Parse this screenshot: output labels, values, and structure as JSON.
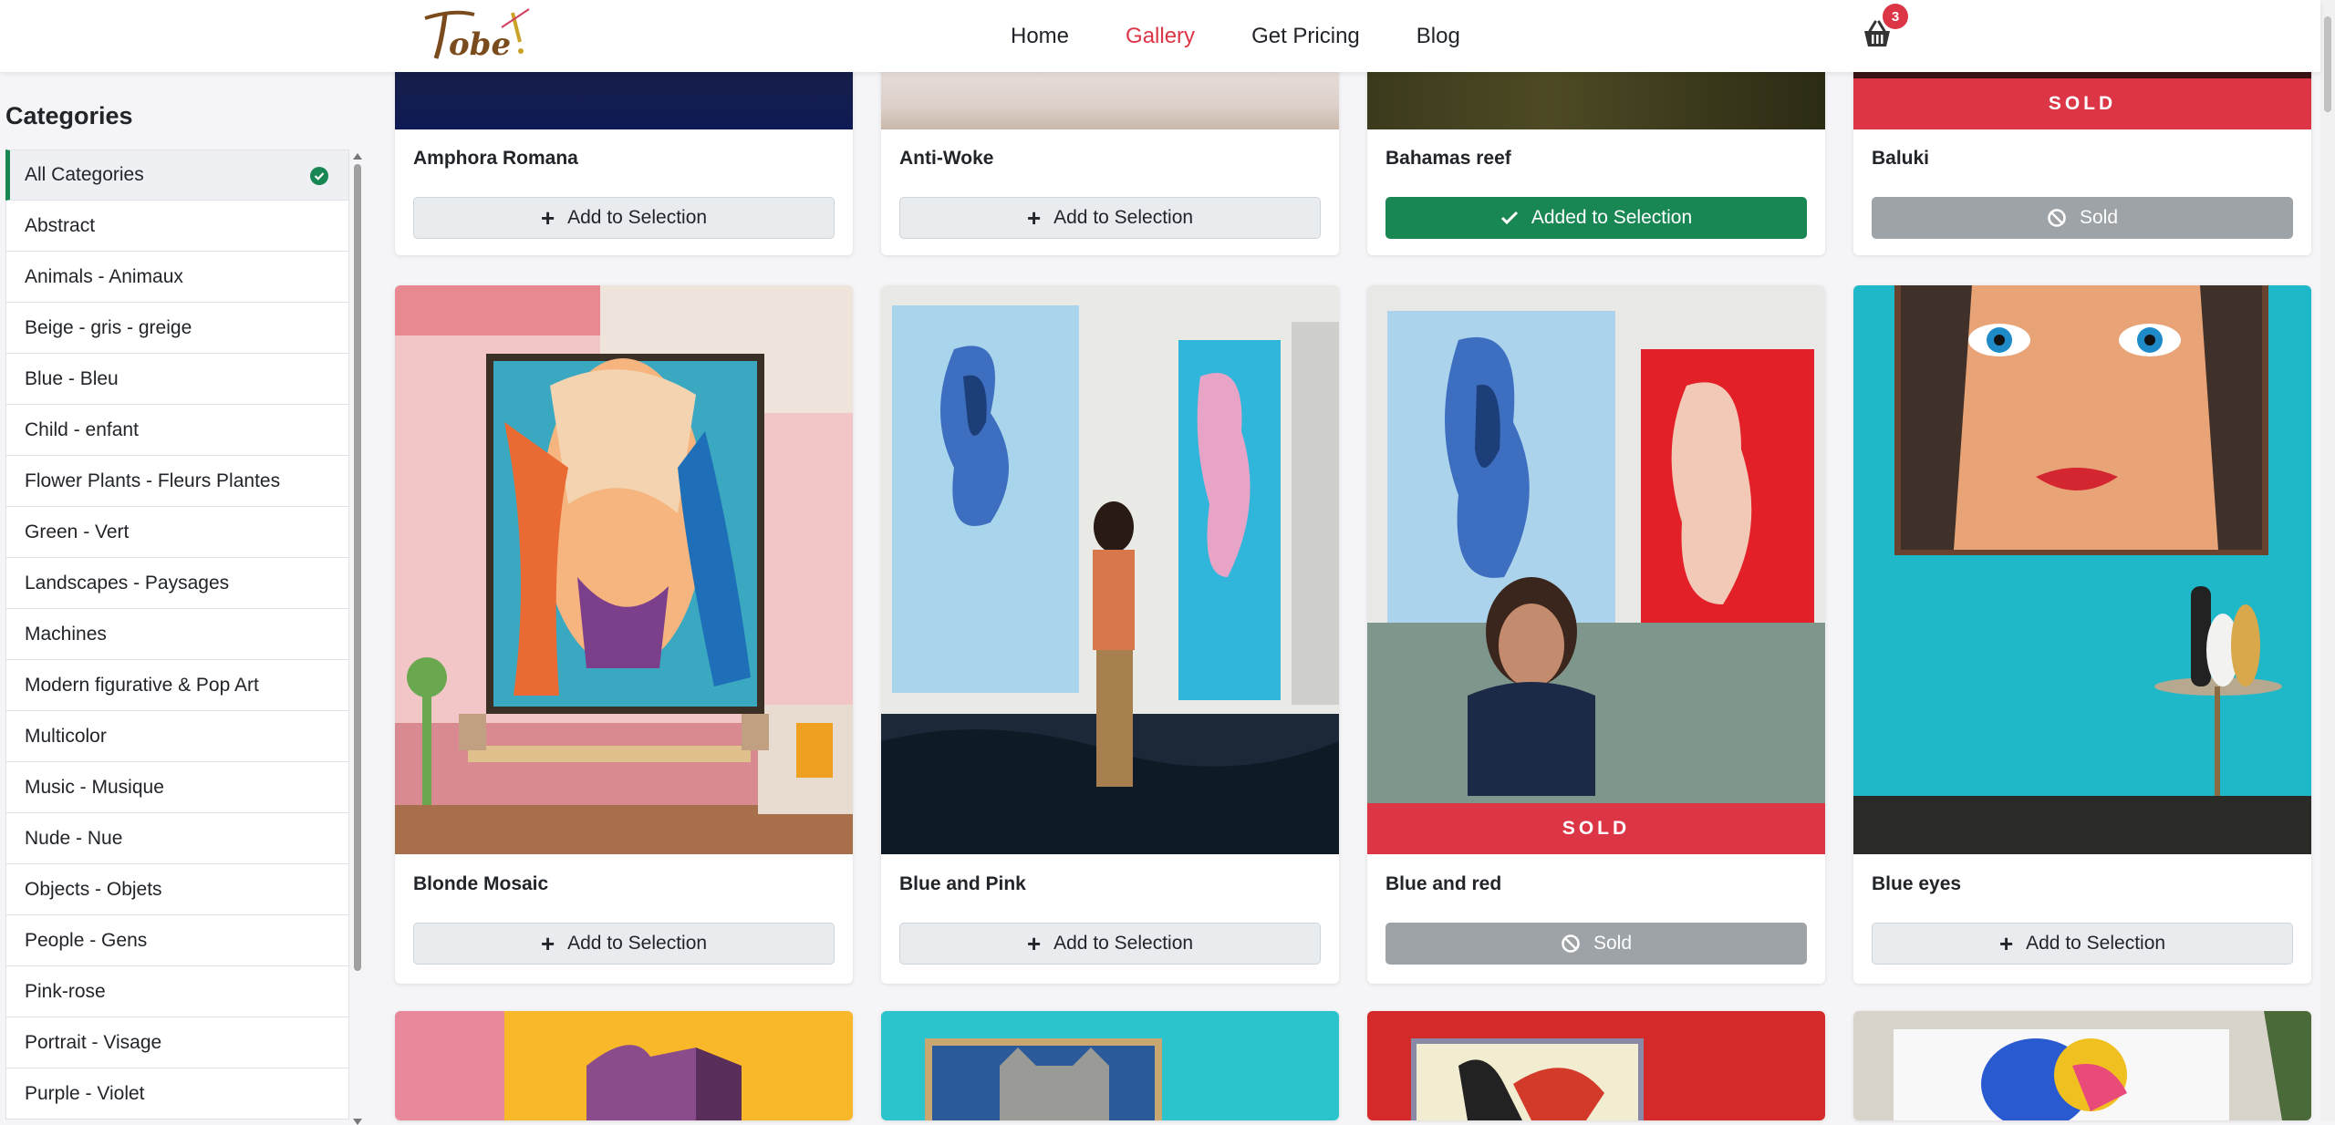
{
  "brand": {
    "logo_text": "Tobe!"
  },
  "nav": {
    "items": [
      {
        "label": "Home",
        "active": false
      },
      {
        "label": "Gallery",
        "active": true
      },
      {
        "label": "Get Pricing",
        "active": false
      },
      {
        "label": "Blog",
        "active": false
      }
    ],
    "cart_count": "3"
  },
  "sidebar": {
    "title": "Categories",
    "items": [
      {
        "label": "All Categories",
        "active": true
      },
      {
        "label": "Abstract"
      },
      {
        "label": "Animals - Animaux"
      },
      {
        "label": "Beige - gris - greige"
      },
      {
        "label": "Blue - Bleu"
      },
      {
        "label": "Child - enfant"
      },
      {
        "label": "Flower Plants - Fleurs Plantes"
      },
      {
        "label": "Green - Vert"
      },
      {
        "label": "Landscapes - Paysages"
      },
      {
        "label": "Machines"
      },
      {
        "label": "Modern figurative & Pop Art"
      },
      {
        "label": "Multicolor"
      },
      {
        "label": "Music - Musique"
      },
      {
        "label": "Nude - Nue"
      },
      {
        "label": "Objects - Objets"
      },
      {
        "label": "People - Gens"
      },
      {
        "label": "Pink-rose"
      },
      {
        "label": "Portrait - Visage"
      },
      {
        "label": "Purple - Violet"
      }
    ]
  },
  "gallery": {
    "row1": [
      {
        "title": "Amphora Romana",
        "button": "Add to Selection",
        "state": "add"
      },
      {
        "title": "Anti-Woke",
        "button": "Add to Selection",
        "state": "add"
      },
      {
        "title": "Bahamas reef",
        "button": "Added to Selection",
        "state": "added"
      },
      {
        "title": "Baluki",
        "button": "Sold",
        "state": "sold",
        "banner": "SOLD"
      }
    ],
    "row2": [
      {
        "title": "Blonde Mosaic",
        "button": "Add to Selection",
        "state": "add"
      },
      {
        "title": "Blue and Pink",
        "button": "Add to Selection",
        "state": "add"
      },
      {
        "title": "Blue and red",
        "button": "Sold",
        "state": "sold",
        "banner": "SOLD"
      },
      {
        "title": "Blue eyes",
        "button": "Add to Selection",
        "state": "add"
      }
    ]
  },
  "colors": {
    "accent": "#dc3545",
    "success": "#198754",
    "muted": "#9ea3a8"
  }
}
